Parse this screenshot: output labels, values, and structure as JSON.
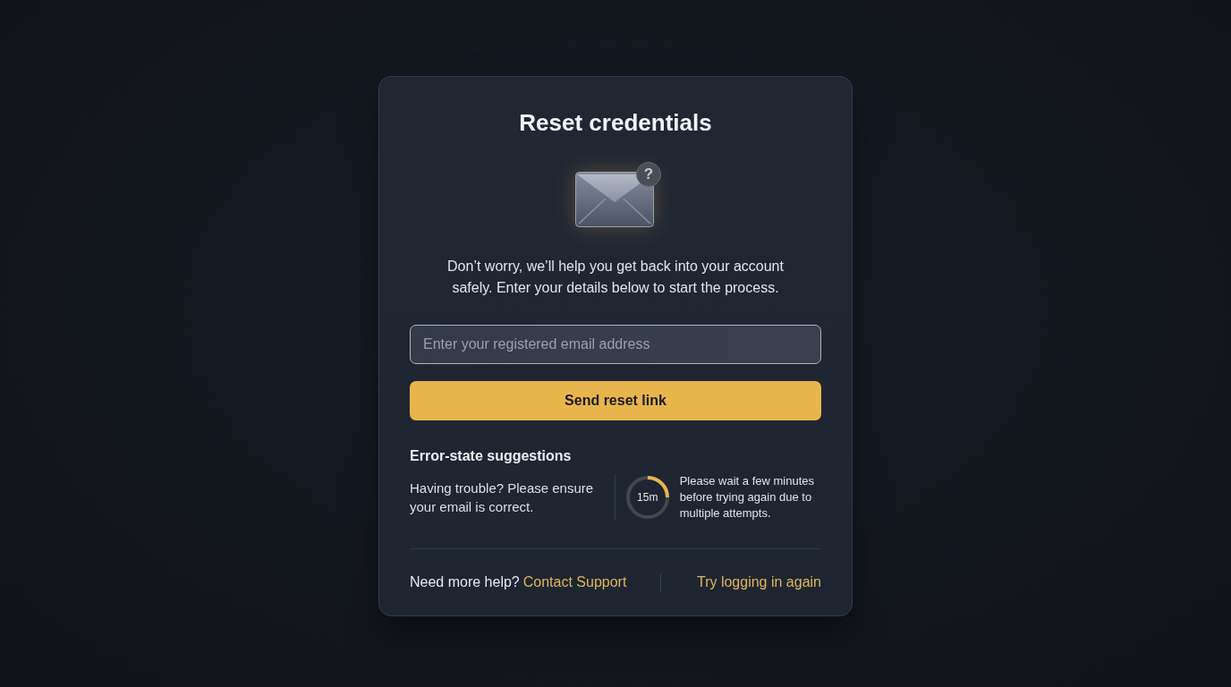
{
  "dialog": {
    "title": "Reset credentials",
    "badge": "?",
    "description": "Don’t worry, we’ll help you get back into your account safely. Enter your details below to start the process."
  },
  "email_field": {
    "placeholder": "Enter your registered email address"
  },
  "submit_button": {
    "label": "Send reset link"
  },
  "suggestions": {
    "heading": "Error-state suggestions",
    "hint": "Having trouble? Please ensure your email is correct.",
    "timer": {
      "reading": "15m",
      "level": 0.25
    },
    "wait_message": "Please wait a few minutes before trying again due to multiple attempts."
  },
  "footer": {
    "help_text": "Need more help?",
    "contact_link": "Contact Support",
    "retry_link": "Try logging in again"
  }
}
